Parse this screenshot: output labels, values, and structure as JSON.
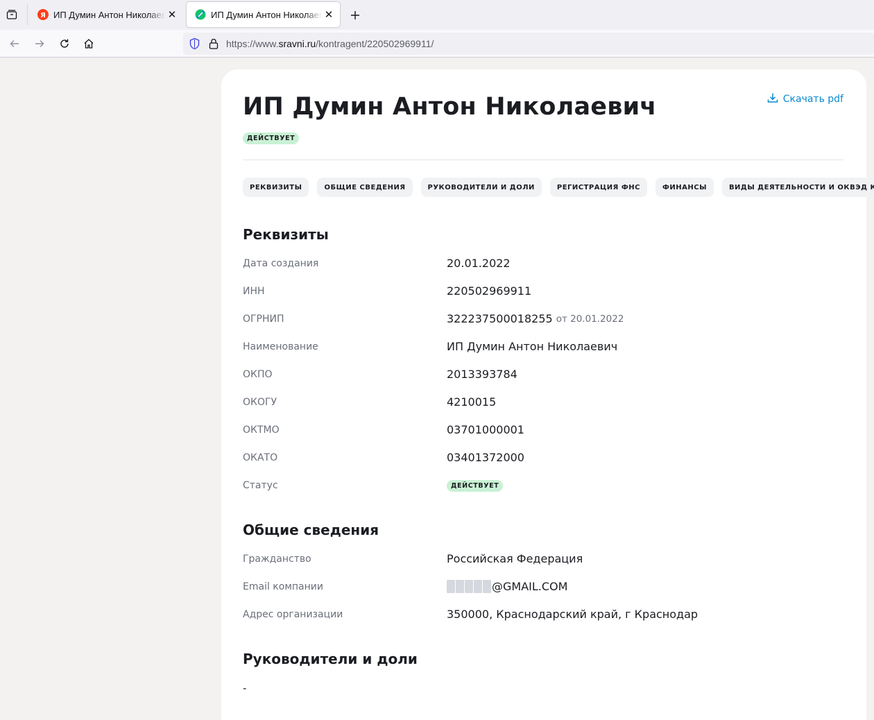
{
  "browser": {
    "tabs": [
      {
        "title": "ИП Думин Антон Николаевич",
        "favicon": "yandex-icon",
        "favicon_color": "#fc3f1d",
        "active": false
      },
      {
        "title": "ИП Думин Антон Николаевич",
        "favicon": "sravni-icon",
        "favicon_color": "#15c26b",
        "active": true
      }
    ],
    "url": {
      "scheme": "https://www.",
      "host": "sravni.ru",
      "path": "/kontragent/220502969911/"
    }
  },
  "page": {
    "title": "ИП Думин Антон Николаевич",
    "status_badge": "ДЕЙСТВУЕТ",
    "download_label": "Скачать pdf",
    "chips": [
      "РЕКВИЗИТЫ",
      "ОБЩИЕ СВЕДЕНИЯ",
      "РУКОВОДИТЕЛИ И ДОЛИ",
      "РЕГИСТРАЦИЯ ФНС",
      "ФИНАНСЫ",
      "ВИДЫ ДЕЯТЕЛЬНОСТИ И ОКВЭД КОД"
    ],
    "requisites": {
      "title": "Реквизиты",
      "rows": [
        {
          "label": "Дата создания",
          "value": "20.01.2022"
        },
        {
          "label": "ИНН",
          "value": "220502969911"
        },
        {
          "label": "ОГРНИП",
          "value": "322237500018255",
          "extra": "от 20.01.2022"
        },
        {
          "label": "Наименование",
          "value": "ИП Думин Антон Николаевич"
        },
        {
          "label": "ОКПО",
          "value": "2013393784"
        },
        {
          "label": "ОКОГУ",
          "value": "4210015"
        },
        {
          "label": "ОКТМО",
          "value": "03701000001"
        },
        {
          "label": "ОКАТО",
          "value": "03401372000"
        },
        {
          "label": "Статус",
          "badge": "ДЕЙСТВУЕТ"
        }
      ]
    },
    "general": {
      "title": "Общие сведения",
      "rows": [
        {
          "label": "Гражданство",
          "value": "Российская Федерация"
        },
        {
          "label": "Email компании",
          "value": "@GMAIL.COM"
        },
        {
          "label": "Адрес организации",
          "value": "350000, Краснодарский край, г Краснодар"
        }
      ]
    },
    "managers": {
      "title": "Руководители и доли",
      "value": "-"
    }
  },
  "colors": {
    "accent": "#0a8ad0",
    "badge_bg": "#c9f1d4"
  }
}
